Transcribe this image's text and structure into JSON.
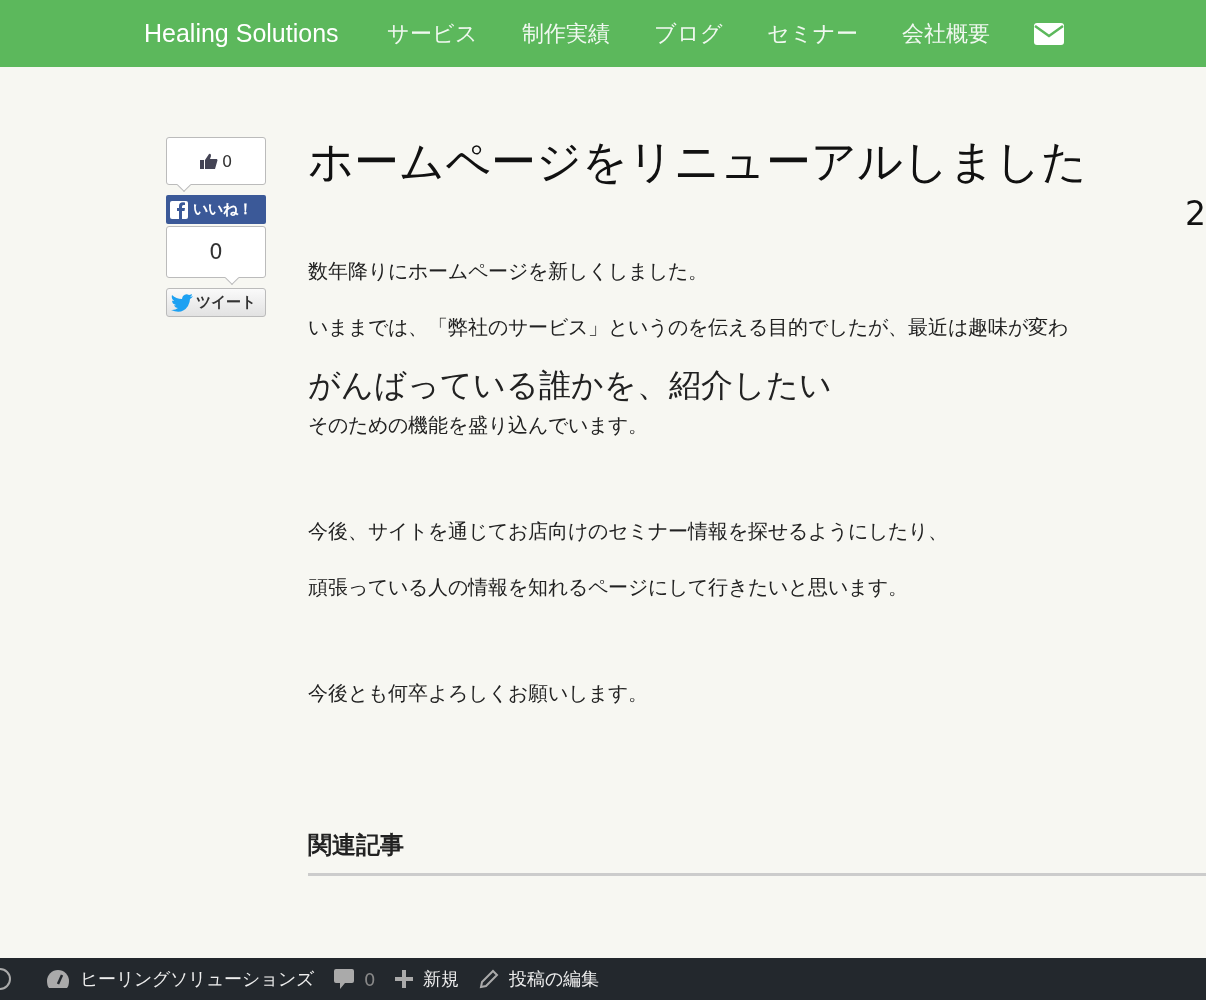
{
  "nav": {
    "brand": "Healing Solutions",
    "items": [
      "サービス",
      "制作実績",
      "ブログ",
      "セミナー",
      "会社概要"
    ]
  },
  "share": {
    "like_count": "0",
    "fb_label": "いいね！",
    "tweet_count": "0",
    "tweet_label": "ツイート"
  },
  "post": {
    "title": "ホームページをリニューアルしました",
    "date": "2",
    "blocks": [
      {
        "kind": "p",
        "text": "数年降りにホームページを新しくしました。"
      },
      {
        "kind": "p",
        "text": "いままでは、「弊社のサービス」というのを伝える目的でしたが、最近は趣味が変わ"
      },
      {
        "kind": "h",
        "text": "がんばっている誰かを、紹介したい"
      },
      {
        "kind": "p",
        "text": "そのための機能を盛り込んでいます。"
      },
      {
        "kind": "gap"
      },
      {
        "kind": "p",
        "text": "今後、サイトを通じてお店向けのセミナー情報を探せるようにしたり、"
      },
      {
        "kind": "p",
        "text": "頑張っている人の情報を知れるページにして行きたいと思います。"
      },
      {
        "kind": "gap"
      },
      {
        "kind": "p",
        "text": "今後とも何卒よろしくお願いします。"
      }
    ],
    "related_heading": "関連記事"
  },
  "admin_bar": {
    "site": "ヒーリングソリューションズ",
    "comments": "0",
    "new": "新規",
    "edit": "投稿の編集"
  }
}
